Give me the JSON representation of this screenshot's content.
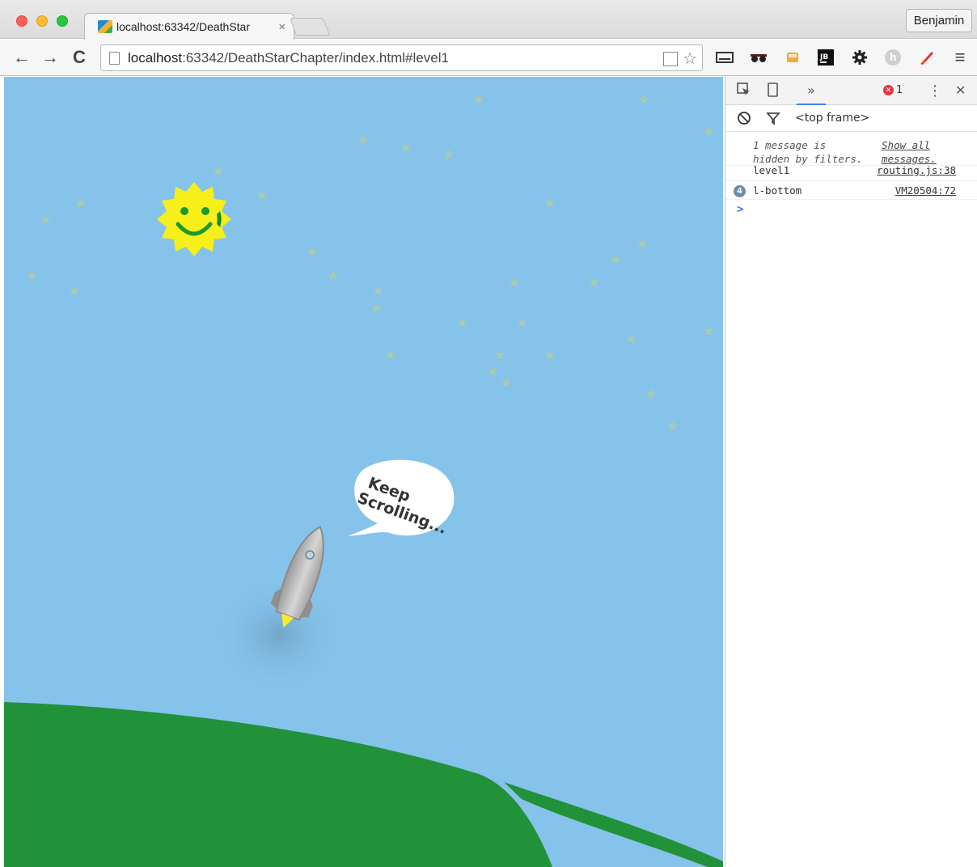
{
  "tab": {
    "title": "localhost:63342/DeathStar",
    "close": "×"
  },
  "profile": {
    "name": "Benjamin"
  },
  "toolbar": {
    "back": "←",
    "forward": "→",
    "reload": "C",
    "url_host": "localhost",
    "url_rest": ":63342/DeathStarChapter/index.html#level1",
    "star": "☆",
    "menu": "≡"
  },
  "page": {
    "speech_line1": "Keep",
    "speech_line2": "Scrolling..."
  },
  "devtools": {
    "more_tabs": "»",
    "error_count": "1",
    "kebab": "⋮",
    "close": "✕",
    "frame": "<top frame>",
    "hidden_note_line1": "1 message is",
    "hidden_note_line2": "hidden by filters.",
    "show_all_line1": "Show all",
    "show_all_line2": "messages.",
    "messages": [
      {
        "text": "level1",
        "source": "routing.js:38",
        "count": ""
      },
      {
        "text": "l-bottom",
        "source": "VM20504:72",
        "count": "4"
      }
    ],
    "prompt": ">"
  },
  "colors": {
    "sky": "#85c3ea",
    "ground": "#21913a",
    "sun": "#f6ef1a"
  }
}
